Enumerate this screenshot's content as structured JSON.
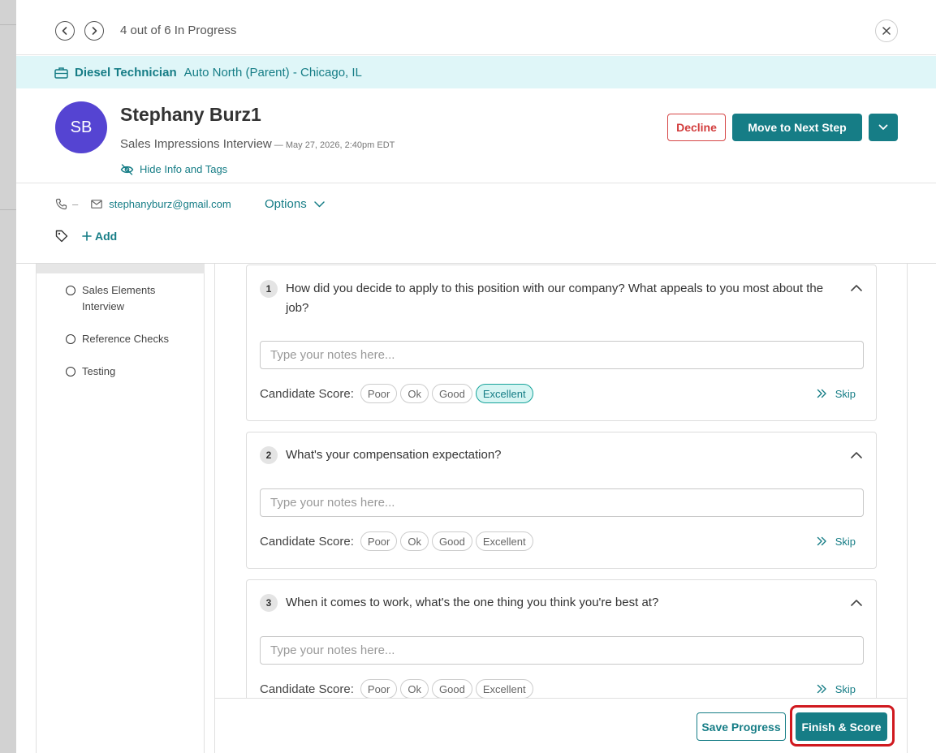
{
  "topbar": {
    "progress_text": "4 out of 6 In Progress"
  },
  "job": {
    "title": "Diesel Technician",
    "location": "Auto North (Parent) - Chicago, IL"
  },
  "candidate": {
    "initials": "SB",
    "name": "Stephany Burz1",
    "interview_name": "Sales Impressions Interview",
    "interview_date": " — May 27, 2026, 2:40pm EDT",
    "hide_info_label": "Hide Info and Tags",
    "phone": "–",
    "email": "stephanyburz@gmail.com",
    "options_label": "Options",
    "add_tag_label": "Add"
  },
  "actions": {
    "decline_label": "Decline",
    "move_label": "Move to Next Step"
  },
  "steps": [
    {
      "label": "Sales Elements Interview"
    },
    {
      "label": "Reference Checks"
    },
    {
      "label": "Testing"
    }
  ],
  "questions": [
    {
      "number": "1",
      "text": "How did you decide to apply to this position with our company? What appeals to you most about the job?",
      "notes_placeholder": "Type your notes here...",
      "score_label": "Candidate Score:",
      "scores": [
        "Poor",
        "Ok",
        "Good",
        "Excellent"
      ],
      "selected_score": "Excellent",
      "skip_label": "Skip"
    },
    {
      "number": "2",
      "text": "What's your compensation expectation?",
      "notes_placeholder": "Type your notes here...",
      "score_label": "Candidate Score:",
      "scores": [
        "Poor",
        "Ok",
        "Good",
        "Excellent"
      ],
      "selected_score": null,
      "skip_label": "Skip"
    },
    {
      "number": "3",
      "text": "When it comes to work, what's the one thing you think you're best at?",
      "notes_placeholder": "Type your notes here...",
      "score_label": "Candidate Score:",
      "scores": [
        "Poor",
        "Ok",
        "Good",
        "Excellent"
      ],
      "selected_score": null,
      "skip_label": "Skip"
    }
  ],
  "footer": {
    "save_label": "Save Progress",
    "finish_label": "Finish & Score"
  },
  "colors": {
    "accent": "#167d86",
    "avatar": "#5544d2",
    "banner": "#dff6f8",
    "decline": "#d23c3c",
    "highlight_outline": "#d0191f",
    "selected_pill": "#d6f5f3"
  },
  "icons": {
    "prev": "chevron-left-icon",
    "next": "chevron-right-icon",
    "close": "close-icon",
    "job": "briefcase-icon",
    "hide": "eye-slash-icon",
    "phone": "phone-icon",
    "email": "mail-icon",
    "options": "chevron-down-icon",
    "tag": "tag-icon",
    "add": "plus-icon",
    "collapse": "chevron-up-icon",
    "skip": "double-chevron-right-icon"
  }
}
